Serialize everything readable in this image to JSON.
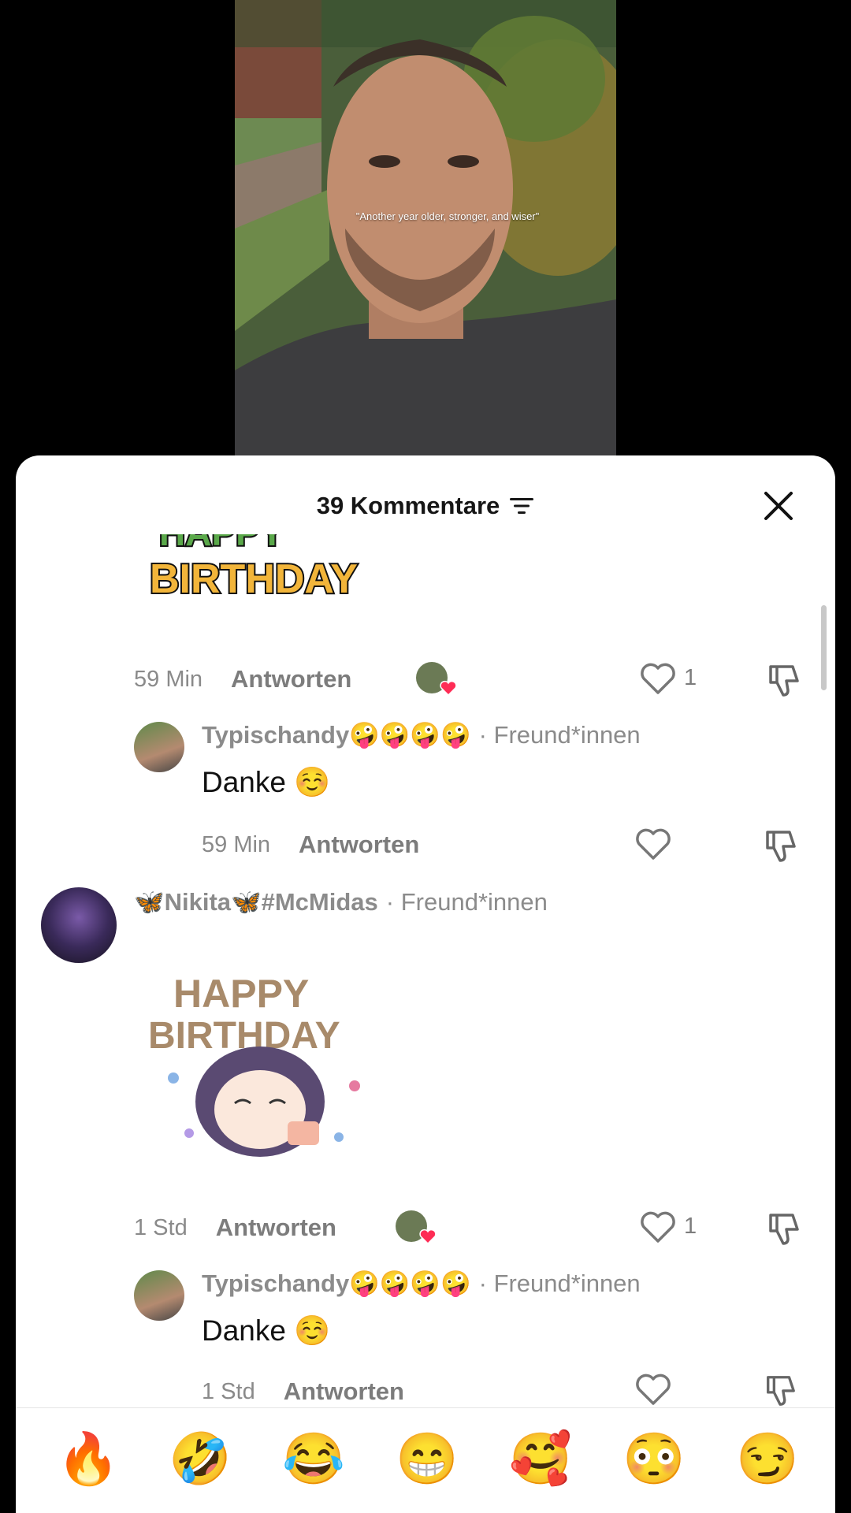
{
  "video": {
    "overlay_text": "\"Another year older, stronger, and wiser\""
  },
  "comments_sheet": {
    "title": "39 Kommentare",
    "close_label": "close",
    "threads": [
      {
        "sticker_text_top": "HAPPY",
        "sticker_text_bottom": "BIRTHDAY",
        "time": "59 Min",
        "reply_label": "Antworten",
        "likes": "1"
      },
      {
        "username": "Typischandy🤪🤪🤪🤪",
        "friend_tag": "· Freund*innen",
        "text": "Danke ☺️",
        "time": "59 Min",
        "reply_label": "Antworten"
      },
      {
        "username": "🦋Nikita🦋#McMidas",
        "friend_tag": "· Freund*innen",
        "sticker_text_top": "HAPPY",
        "sticker_text_bottom": "BIRTHDAY",
        "time": "1 Std",
        "reply_label": "Antworten",
        "likes": "1"
      },
      {
        "username": "Typischandy🤪🤪🤪🤪",
        "friend_tag": "· Freund*innen",
        "text": "Danke ☺️",
        "time": "1 Std",
        "reply_label": "Antworten"
      }
    ]
  },
  "emoji_bar": [
    "🔥",
    "🤣",
    "😂",
    "😁",
    "🥰",
    "😳",
    "😏"
  ],
  "colors": {
    "sheet_bg": "#ffffff",
    "muted_text": "#8a8a8a",
    "heart_red": "#fe2c55"
  }
}
